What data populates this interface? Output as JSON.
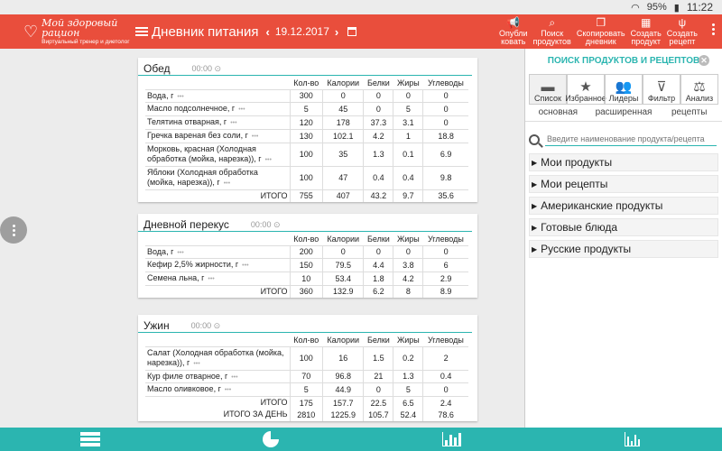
{
  "status": {
    "battery": "95%",
    "time": "11:22"
  },
  "app": {
    "brand_name": "Мой здоровый рацион",
    "brand_sub": "Виртуальный тренер и диетолог",
    "title": "Дневник питания",
    "date": "19.12.2017"
  },
  "actions": [
    {
      "l1": "Опубли",
      "l2": "ковать",
      "icon": "megaphone-icon"
    },
    {
      "l1": "Поиск",
      "l2": "продуктов",
      "icon": "search-icon"
    },
    {
      "l1": "Скопировать",
      "l2": "дневник",
      "icon": "copy-icon"
    },
    {
      "l1": "Создать",
      "l2": "продукт",
      "icon": "create-product-icon"
    },
    {
      "l1": "Создать",
      "l2": "рецепт",
      "icon": "fork-knife-icon"
    }
  ],
  "columns": [
    "Кол-во",
    "Калории",
    "Белки",
    "Жиры",
    "Углеводы"
  ],
  "meals": [
    {
      "name": "Обед",
      "time": "00:00",
      "rows": [
        {
          "name": "Вода, г",
          "qty": "300",
          "cal": "0",
          "p": "0",
          "f": "0",
          "c": "0"
        },
        {
          "name": "Масло подсолнечное, г",
          "qty": "5",
          "cal": "45",
          "p": "0",
          "f": "5",
          "c": "0"
        },
        {
          "name": "Телятина отварная, г",
          "qty": "120",
          "cal": "178",
          "p": "37.3",
          "f": "3.1",
          "c": "0"
        },
        {
          "name": "Гречка вареная без соли, г",
          "qty": "130",
          "cal": "102.1",
          "p": "4.2",
          "f": "1",
          "c": "18.8"
        },
        {
          "name": "Морковь, красная (Холодная обработка (мойка, нарезка)), г",
          "qty": "100",
          "cal": "35",
          "p": "1.3",
          "f": "0.1",
          "c": "6.9"
        },
        {
          "name": "Яблоки (Холодная обработка (мойка, нарезка)), г",
          "qty": "100",
          "cal": "47",
          "p": "0.4",
          "f": "0.4",
          "c": "9.8"
        }
      ],
      "totals": [
        {
          "label": "ИТОГО",
          "qty": "755",
          "cal": "407",
          "p": "43.2",
          "f": "9.7",
          "c": "35.6"
        }
      ]
    },
    {
      "name": "Дневной перекус",
      "time": "00:00",
      "rows": [
        {
          "name": "Вода, г",
          "qty": "200",
          "cal": "0",
          "p": "0",
          "f": "0",
          "c": "0"
        },
        {
          "name": "Кефир 2,5% жирности, г",
          "qty": "150",
          "cal": "79.5",
          "p": "4.4",
          "f": "3.8",
          "c": "6"
        },
        {
          "name": "Семена льна, г",
          "qty": "10",
          "cal": "53.4",
          "p": "1.8",
          "f": "4.2",
          "c": "2.9"
        }
      ],
      "totals": [
        {
          "label": "ИТОГО",
          "qty": "360",
          "cal": "132.9",
          "p": "6.2",
          "f": "8",
          "c": "8.9"
        }
      ]
    },
    {
      "name": "Ужин",
      "time": "00:00",
      "rows": [
        {
          "name": "Салат (Холодная обработка (мойка, нарезка)), г",
          "qty": "100",
          "cal": "16",
          "p": "1.5",
          "f": "0.2",
          "c": "2"
        },
        {
          "name": "Кур филе отварное, г",
          "qty": "70",
          "cal": "96.8",
          "p": "21",
          "f": "1.3",
          "c": "0.4"
        },
        {
          "name": "Масло оливковое, г",
          "qty": "5",
          "cal": "44.9",
          "p": "0",
          "f": "5",
          "c": "0"
        }
      ],
      "totals": [
        {
          "label": "ИТОГО",
          "qty": "175",
          "cal": "157.7",
          "p": "22.5",
          "f": "6.5",
          "c": "2.4"
        },
        {
          "label": "ИТОГО ЗА ДЕНЬ",
          "qty": "2810",
          "cal": "1225.9",
          "p": "105.7",
          "f": "52.4",
          "c": "78.6"
        }
      ]
    }
  ],
  "panel": {
    "title": "ПОИСК ПРОДУКТОВ И РЕЦЕПТОВ",
    "tabs": [
      {
        "label": "Список",
        "icon": "folder-icon"
      },
      {
        "label": "Избранное",
        "icon": "star-icon"
      },
      {
        "label": "Лидеры",
        "icon": "users-icon"
      },
      {
        "label": "Фильтр",
        "icon": "filter-icon"
      },
      {
        "label": "Анализ",
        "icon": "scales-icon"
      }
    ],
    "subtabs": [
      "основная",
      "расширенная",
      "рецепты"
    ],
    "search_placeholder": "Введите наименование продукта/рецепта",
    "categories": [
      "Мои продукты",
      "Мои рецепты",
      "Американские продукты",
      "Готовые блюда",
      "Русские продукты"
    ]
  },
  "bottom": [
    {
      "icon": "diary-list-icon"
    },
    {
      "icon": "pie-chart-icon"
    },
    {
      "icon": "bar-chart-icon"
    },
    {
      "icon": "line-chart-icon"
    }
  ]
}
